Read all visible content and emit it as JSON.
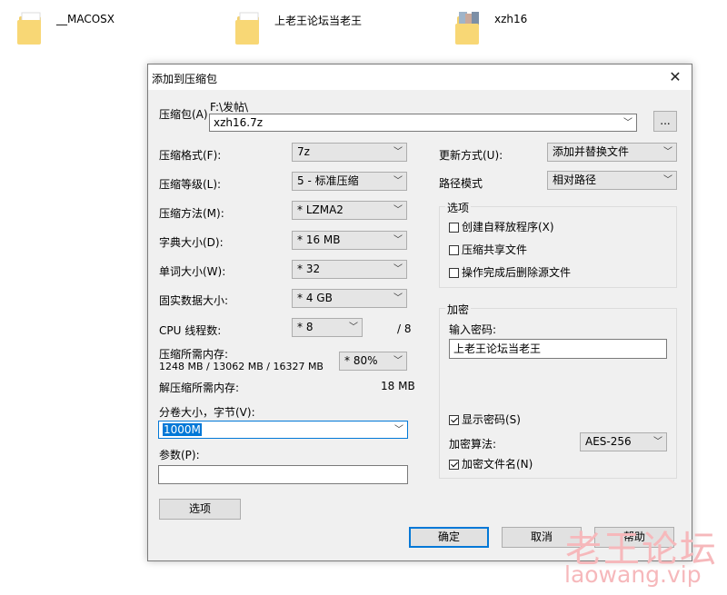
{
  "desktop": {
    "icons": [
      {
        "label": "__MACOSX"
      },
      {
        "label": "上老王论坛当老王"
      },
      {
        "label": "xzh16"
      }
    ]
  },
  "dialog": {
    "title": "添加到压缩包",
    "archive_label": "压缩包(A)",
    "archive_path": "F:\\发帖\\",
    "archive_name": "xzh16.7z",
    "browse_label": "...",
    "format_label": "压缩格式(F):",
    "format_value": "7z",
    "level_label": "压缩等级(L):",
    "level_value": "5 - 标准压缩",
    "method_label": "压缩方法(M):",
    "method_value": "* LZMA2",
    "dict_label": "字典大小(D):",
    "dict_value": "* 16 MB",
    "word_label": "单词大小(W):",
    "word_value": "* 32",
    "solid_label": "固实数据大小:",
    "solid_value": "* 4 GB",
    "cpu_label": "CPU 线程数:",
    "cpu_value": "* 8",
    "cpu_total": "/ 8",
    "mem_comp_label": "压缩所需内存:",
    "mem_comp_value": "1248 MB / 13062 MB / 16327 MB",
    "mem_percent": "* 80%",
    "mem_decomp_label": "解压缩所需内存:",
    "mem_decomp_value": "18 MB",
    "split_label": "分卷大小，字节(V):",
    "split_value": "1000M",
    "params_label": "参数(P):",
    "params_value": "",
    "options_button": "选项",
    "update_label": "更新方式(U):",
    "update_value": "添加并替换文件",
    "path_label": "路径模式",
    "path_value": "相对路径",
    "options_group": {
      "title": "选项",
      "sfx": "创建自释放程序(X)",
      "shared": "压缩共享文件",
      "delete": "操作完成后删除源文件"
    },
    "encryption": {
      "title": "加密",
      "password_label": "输入密码:",
      "password_value": "上老王论坛当老王",
      "show_password": "显示密码(S)",
      "method_label": "加密算法:",
      "method_value": "AES-256",
      "encrypt_names": "加密文件名(N)"
    },
    "ok_button": "确定",
    "cancel_button": "取消",
    "help_button": "帮助"
  },
  "watermark": {
    "title": "老王论坛",
    "url": "laowang.vip"
  }
}
